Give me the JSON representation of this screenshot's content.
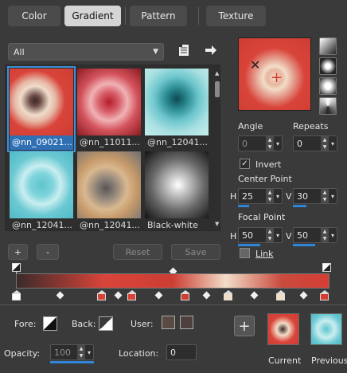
{
  "tabs": [
    {
      "label": "Color"
    },
    {
      "label": "Gradient"
    },
    {
      "label": "Pattern"
    },
    {
      "label": "Texture"
    }
  ],
  "active_tab": "Gradient",
  "library": {
    "filter_value": "All",
    "items": [
      {
        "label": "@nn_09021..."
      },
      {
        "label": "@nn_11011..."
      },
      {
        "label": "@nn_12041..."
      },
      {
        "label": "@nn_12041..."
      },
      {
        "label": "@nn_12041..."
      },
      {
        "label": "Black-white"
      }
    ],
    "add_label": "+",
    "remove_label": "-",
    "reset_label": "Reset",
    "save_label": "Save"
  },
  "settings": {
    "angle_label": "Angle",
    "angle_value": "0",
    "repeats_label": "Repeats",
    "repeats_value": "0",
    "invert_label": "Invert",
    "invert_checked": true,
    "center_point_label": "Center Point",
    "center_h_label": "H",
    "center_h": "25",
    "center_v_label": "V",
    "center_v": "30",
    "focal_point_label": "Focal Point",
    "focal_h_label": "H",
    "focal_h": "50",
    "focal_v_label": "V",
    "focal_v": "50",
    "link_label": "Link"
  },
  "stop_editor": {
    "fore_label": "Fore:",
    "back_label": "Back:",
    "user_label": "User:",
    "opacity_label": "Opacity:",
    "opacity_value": "100",
    "location_label": "Location:",
    "location_value": "0"
  },
  "history": {
    "add_label": "+",
    "current_label": "Current",
    "previous_label": "Previous"
  },
  "colors": {
    "accent_blue": "#2f86d8",
    "gradient_red": "#d9443a",
    "gradient_cream": "#f2ddc7",
    "user_swatch_1": "#5a4a44",
    "user_swatch_2": "#4e403c"
  }
}
